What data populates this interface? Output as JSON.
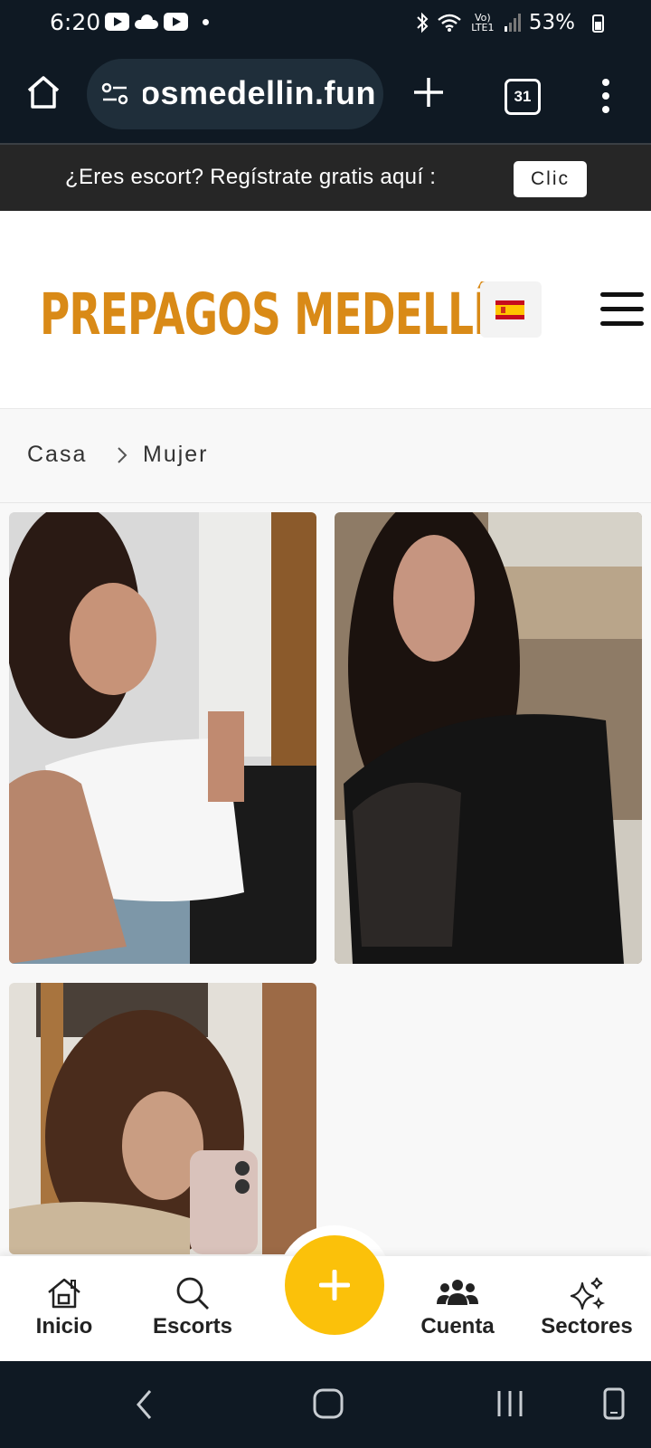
{
  "status_bar": {
    "time": "6:20",
    "network_label": "Vo) LTE1",
    "battery": "53%"
  },
  "browser": {
    "url": "prepagosmedellin.fun",
    "tab_count": "31"
  },
  "banner": {
    "text": "¿Eres escort? Regístrate gratis aquí :",
    "button_label": "Clic"
  },
  "header": {
    "logo_text": "PREPAGOS MEDELLÍN",
    "language_flag": "spain-flag"
  },
  "breadcrumb": {
    "items": [
      "Casa",
      "Mujer"
    ]
  },
  "gallery": {
    "cards": [
      {
        "description": "profile-photo-1"
      },
      {
        "description": "profile-photo-2"
      },
      {
        "description": "profile-photo-3"
      }
    ]
  },
  "bottom_nav": {
    "items": [
      {
        "label": "Inicio",
        "icon": "home-icon"
      },
      {
        "label": "Escorts",
        "icon": "search-icon"
      },
      {
        "label": "Cuenta",
        "icon": "users-icon"
      },
      {
        "label": "Sectores",
        "icon": "sparkles-icon"
      }
    ],
    "fab_icon": "plus-icon"
  },
  "colors": {
    "accent": "#fbc10a",
    "logo": "#d98a17",
    "status_bar": "#0f1923"
  }
}
